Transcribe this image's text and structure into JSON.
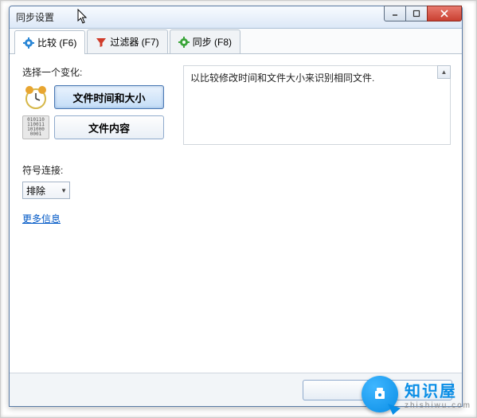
{
  "window": {
    "title": "同步设置"
  },
  "tabs": {
    "compare": {
      "label": "比较 (F6)"
    },
    "filter": {
      "label": "过滤器 (F7)"
    },
    "sync": {
      "label": "同步 (F8)"
    }
  },
  "compare_pane": {
    "select_label": "选择一个变化:",
    "option_time_size": "文件时间和大小",
    "option_content": "文件内容",
    "description": "以比较修改时间和文件大小来识别相同文件."
  },
  "symlink": {
    "label": "符号连接:",
    "value": "排除"
  },
  "links": {
    "more_info": "更多信息"
  },
  "footer": {
    "ok": "",
    "cancel": ""
  },
  "watermark": {
    "main": "知识屋",
    "sub": "zhishiwu.com"
  }
}
